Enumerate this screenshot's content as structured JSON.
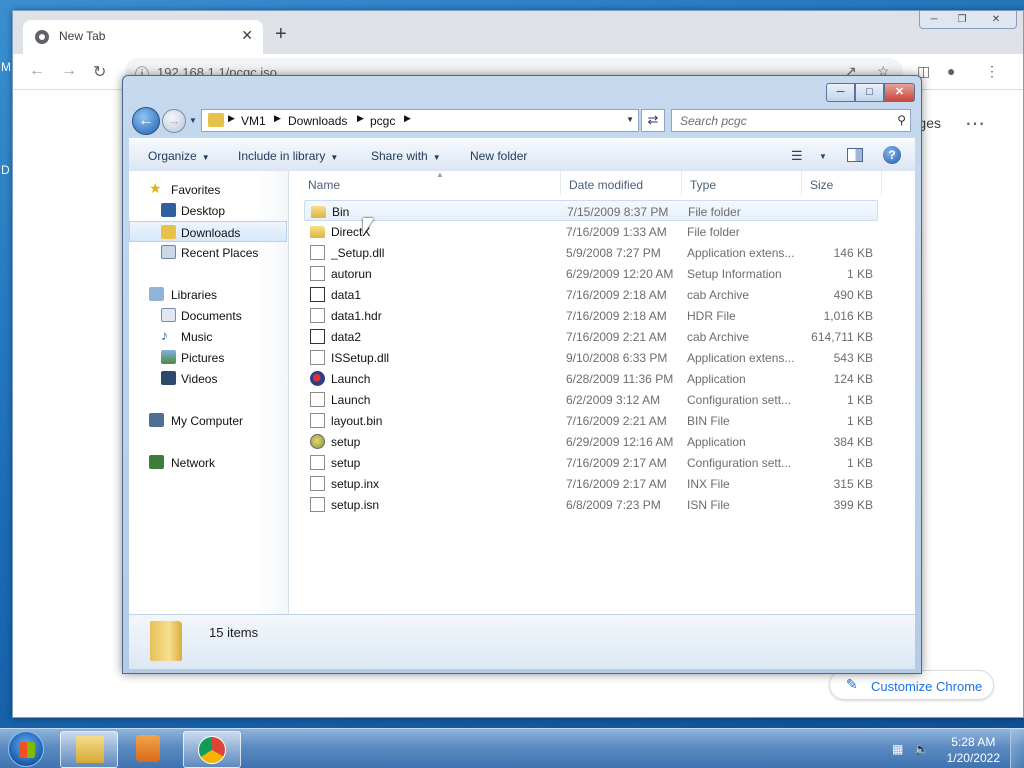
{
  "desktop": {
    "left_letters": [
      "M",
      "D"
    ]
  },
  "chrome": {
    "tab_title": "New Tab",
    "tab_close": "✕",
    "new_tab": "+",
    "url": "192.168.1.1/pcgc.iso",
    "page_partial_text": "ges",
    "customize_label": "Customize Chrome",
    "icons": [
      "chrome-logo-icon",
      "back-icon",
      "forward-icon",
      "reload-icon",
      "info-icon",
      "share-icon",
      "star-icon",
      "sidepanel-icon",
      "profile-icon",
      "menu-icon",
      "apps-grid-icon",
      "pencil-icon"
    ]
  },
  "explorer": {
    "breadcrumbs": [
      "VM1",
      "Downloads",
      "pcgc"
    ],
    "search_placeholder": "Search pcgc",
    "commands": {
      "organize": "Organize",
      "include": "Include in library",
      "share": "Share with",
      "new_folder": "New folder"
    },
    "nav": {
      "favorites": "Favorites",
      "desktop": "Desktop",
      "downloads": "Downloads",
      "recent": "Recent Places",
      "libraries": "Libraries",
      "documents": "Documents",
      "music": "Music",
      "pictures": "Pictures",
      "videos": "Videos",
      "computer": "My Computer",
      "network": "Network"
    },
    "columns": {
      "name": "Name",
      "date": "Date modified",
      "type": "Type",
      "size": "Size"
    },
    "files": [
      {
        "name": "Bin",
        "date": "7/15/2009 8:37 PM",
        "type": "File folder",
        "size": "",
        "icon": "folder-icon"
      },
      {
        "name": "DirectX",
        "date": "7/16/2009 1:33 AM",
        "type": "File folder",
        "size": "",
        "icon": "folder-icon"
      },
      {
        "name": "_Setup.dll",
        "date": "5/9/2008 7:27 PM",
        "type": "Application extens...",
        "size": "146 KB",
        "icon": "dll-icon"
      },
      {
        "name": "autorun",
        "date": "6/29/2009 12:20 AM",
        "type": "Setup Information",
        "size": "1 KB",
        "icon": "config-icon"
      },
      {
        "name": "data1",
        "date": "7/16/2009 2:18 AM",
        "type": "cab Archive",
        "size": "490 KB",
        "icon": "cab-icon"
      },
      {
        "name": "data1.hdr",
        "date": "7/16/2009 2:18 AM",
        "type": "HDR File",
        "size": "1,016 KB",
        "icon": "file-icon"
      },
      {
        "name": "data2",
        "date": "7/16/2009 2:21 AM",
        "type": "cab Archive",
        "size": "614,711 KB",
        "icon": "cab-icon"
      },
      {
        "name": "ISSetup.dll",
        "date": "9/10/2008 6:33 PM",
        "type": "Application extens...",
        "size": "543 KB",
        "icon": "dll-icon"
      },
      {
        "name": "Launch",
        "date": "6/28/2009 11:36 PM",
        "type": "Application",
        "size": "124 KB",
        "icon": "app-icon"
      },
      {
        "name": "Launch",
        "date": "6/2/2009 3:12 AM",
        "type": "Configuration sett...",
        "size": "1 KB",
        "icon": "config-icon"
      },
      {
        "name": "layout.bin",
        "date": "7/16/2009 2:21 AM",
        "type": "BIN File",
        "size": "1 KB",
        "icon": "file-icon"
      },
      {
        "name": "setup",
        "date": "6/29/2009 12:16 AM",
        "type": "Application",
        "size": "384 KB",
        "icon": "setup-icon"
      },
      {
        "name": "setup",
        "date": "7/16/2009 2:17 AM",
        "type": "Configuration sett...",
        "size": "1 KB",
        "icon": "config-icon"
      },
      {
        "name": "setup.inx",
        "date": "7/16/2009 2:17 AM",
        "type": "INX File",
        "size": "315 KB",
        "icon": "file-icon"
      },
      {
        "name": "setup.isn",
        "date": "6/8/2009 7:23 PM",
        "type": "ISN File",
        "size": "399 KB",
        "icon": "file-icon"
      }
    ],
    "item_count": "15 items"
  },
  "taskbar": {
    "time": "5:28 AM",
    "date": "1/20/2022",
    "apps": [
      "windows-explorer-icon",
      "media-player-icon",
      "chrome-icon"
    ]
  },
  "colors": {
    "selection": "#cce8ff",
    "link_blue": "#1a73e8",
    "explorer_frame": "#b4cbe6"
  }
}
